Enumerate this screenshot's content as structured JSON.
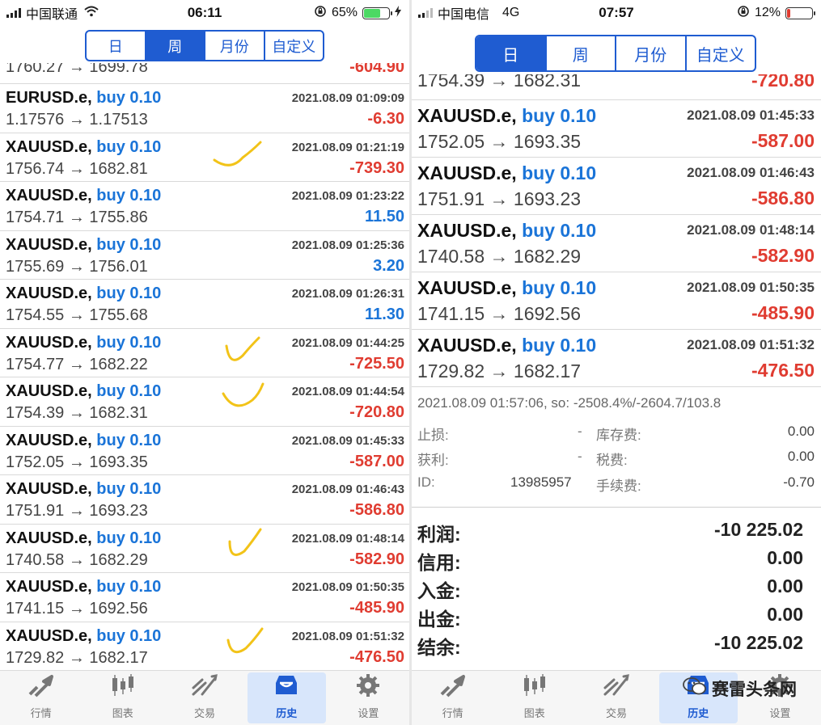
{
  "left": {
    "status": {
      "carrier": "中国联通",
      "time": "06:11",
      "battery_pct": "65%",
      "battery_color": "#4cd964"
    },
    "segments": [
      {
        "label": "日",
        "active": false
      },
      {
        "label": "周",
        "active": true
      },
      {
        "label": "月份",
        "active": false
      },
      {
        "label": "自定义",
        "active": false
      }
    ],
    "partial_row": {
      "prices": "1760.27 → 1699.78",
      "profit": "-604.90"
    },
    "trades": [
      {
        "symbol": "EURUSD.e,",
        "side": "buy 0.10",
        "time": "2021.08.09 01:09:09",
        "prices": "1.17576 → 1.17513",
        "profit": "-6.30",
        "neg": true,
        "check": false
      },
      {
        "symbol": "XAUUSD.e,",
        "side": "buy 0.10",
        "time": "2021.08.09 01:21:19",
        "prices": "1756.74 → 1682.81",
        "profit": "-739.30",
        "neg": true,
        "check": true
      },
      {
        "symbol": "XAUUSD.e,",
        "side": "buy 0.10",
        "time": "2021.08.09 01:23:22",
        "prices": "1754.71 → 1755.86",
        "profit": "11.50",
        "neg": false,
        "check": false
      },
      {
        "symbol": "XAUUSD.e,",
        "side": "buy 0.10",
        "time": "2021.08.09 01:25:36",
        "prices": "1755.69 → 1756.01",
        "profit": "3.20",
        "neg": false,
        "check": false
      },
      {
        "symbol": "XAUUSD.e,",
        "side": "buy 0.10",
        "time": "2021.08.09 01:26:31",
        "prices": "1754.55 → 1755.68",
        "profit": "11.30",
        "neg": false,
        "check": false
      },
      {
        "symbol": "XAUUSD.e,",
        "side": "buy 0.10",
        "time": "2021.08.09 01:44:25",
        "prices": "1754.77 → 1682.22",
        "profit": "-725.50",
        "neg": true,
        "check": true
      },
      {
        "symbol": "XAUUSD.e,",
        "side": "buy 0.10",
        "time": "2021.08.09 01:44:54",
        "prices": "1754.39 → 1682.31",
        "profit": "-720.80",
        "neg": true,
        "check": true
      },
      {
        "symbol": "XAUUSD.e,",
        "side": "buy 0.10",
        "time": "2021.08.09 01:45:33",
        "prices": "1752.05 → 1693.35",
        "profit": "-587.00",
        "neg": true,
        "check": false
      },
      {
        "symbol": "XAUUSD.e,",
        "side": "buy 0.10",
        "time": "2021.08.09 01:46:43",
        "prices": "1751.91 → 1693.23",
        "profit": "-586.80",
        "neg": true,
        "check": false
      },
      {
        "symbol": "XAUUSD.e,",
        "side": "buy 0.10",
        "time": "2021.08.09 01:48:14",
        "prices": "1740.58 → 1682.29",
        "profit": "-582.90",
        "neg": true,
        "check": true
      },
      {
        "symbol": "XAUUSD.e,",
        "side": "buy 0.10",
        "time": "2021.08.09 01:50:35",
        "prices": "1741.15 → 1692.56",
        "profit": "-485.90",
        "neg": true,
        "check": false
      },
      {
        "symbol": "XAUUSD.e,",
        "side": "buy 0.10",
        "time": "2021.08.09 01:51:32",
        "prices": "1729.82 → 1682.17",
        "profit": "-476.50",
        "neg": true,
        "check": true
      }
    ]
  },
  "right": {
    "status": {
      "carrier": "中国电信",
      "network": "4G",
      "time": "07:57",
      "battery_pct": "12%",
      "battery_color": "#e03c31"
    },
    "segments": [
      {
        "label": "日",
        "active": true
      },
      {
        "label": "周",
        "active": false
      },
      {
        "label": "月份",
        "active": false
      },
      {
        "label": "自定义",
        "active": false
      }
    ],
    "partial_row": {
      "prices": "1754.39 → 1682.31",
      "profit": "-720.80"
    },
    "trades": [
      {
        "symbol": "XAUUSD.e,",
        "side": "buy 0.10",
        "time": "2021.08.09 01:45:33",
        "prices": "1752.05 → 1693.35",
        "profit": "-587.00"
      },
      {
        "symbol": "XAUUSD.e,",
        "side": "buy 0.10",
        "time": "2021.08.09 01:46:43",
        "prices": "1751.91 → 1693.23",
        "profit": "-586.80"
      },
      {
        "symbol": "XAUUSD.e,",
        "side": "buy 0.10",
        "time": "2021.08.09 01:48:14",
        "prices": "1740.58 → 1682.29",
        "profit": "-582.90"
      },
      {
        "symbol": "XAUUSD.e,",
        "side": "buy 0.10",
        "time": "2021.08.09 01:50:35",
        "prices": "1741.15 → 1692.56",
        "profit": "-485.90"
      },
      {
        "symbol": "XAUUSD.e,",
        "side": "buy 0.10",
        "time": "2021.08.09 01:51:32",
        "prices": "1729.82 → 1682.17",
        "profit": "-476.50"
      }
    ],
    "detail": {
      "line": "2021.08.09 01:57:06, so: -2508.4%/-2604.7/103.8",
      "stop_loss_label": "止损:",
      "stop_loss_value": "-",
      "take_profit_label": "获利:",
      "take_profit_value": "-",
      "id_label": "ID:",
      "id_value": "13985957",
      "swap_label": "库存费:",
      "swap_value": "0.00",
      "tax_label": "税费:",
      "tax_value": "0.00",
      "commission_label": "手续费:",
      "commission_value": "-0.70"
    },
    "summary": [
      {
        "label": "利润:",
        "value": "-10 225.02"
      },
      {
        "label": "信用:",
        "value": "0.00"
      },
      {
        "label": "入金:",
        "value": "0.00"
      },
      {
        "label": "出金:",
        "value": "0.00"
      },
      {
        "label": "结余:",
        "value": "-10 225.02"
      }
    ],
    "watermark": "赛雷头条网"
  },
  "tabs": [
    {
      "label": "行情",
      "icon": "quotes-icon",
      "active": false
    },
    {
      "label": "图表",
      "icon": "chart-icon",
      "active": false
    },
    {
      "label": "交易",
      "icon": "trade-icon",
      "active": false
    },
    {
      "label": "历史",
      "icon": "history-icon",
      "active": true
    },
    {
      "label": "设置",
      "icon": "settings-icon",
      "active": false
    }
  ]
}
